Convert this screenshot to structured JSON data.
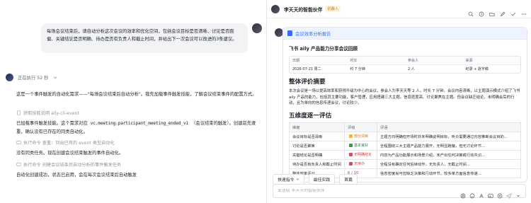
{
  "left": {
    "user_message": "每场会议结束后，请自动分析这次会议的效率和优化空间，包括会议目标是否清晰、讨论是否跑偏、关键结论是否明确、待办是否有负责人和截止时间，并给出下一次会议可以改进的3条建议。",
    "status": "正在执行 52 秒",
    "para1": "这是一个事件触发的自动化需求——\"每场会议结束后自动分析\"。我先加载事件触发技能，了解会议结束事件的配置方式。",
    "step1": "获取技能说明 aily-cli-event",
    "para2_a": "已加载事件触发技能。这个需求对应",
    "para2_code": "vc.meeting.participant_meeting_ended_v1",
    "para2_b": "（会议结束的触发）。创建前先查重，确认没有已存在的同类自动化。",
    "step2": "执行命令 查重：列出已有的 event 类型自动化",
    "para3": "没有同类任务。现在创建会议结束触发的事件自动化。",
    "step3": "执行命令 创建会议结束后自动分析的事件触发任务",
    "para4": "自动化创建成功，状态已启用，会在每次会议结束后自动触发"
  },
  "right": {
    "topbar": {
      "title": "李天天的智能伙伴",
      "badge": "机器人"
    },
    "card": {
      "header": "会议效率分析报告",
      "doc_title": "飞书 aily 产品能力分享会议回顾",
      "meta": {
        "labels": [
          "日期",
          "时长",
          "参会人",
          "来源"
        ],
        "values": [
          "2026-07-21 周二",
          "约 7 分钟",
          "2 人",
          "纪录 + 逐字稿"
        ]
      },
      "section1_title": "整体评价摘要",
      "summary": "本次会议是一场以提高效率和获得升级为中心的会议，参会人为李天天等 2 人，时长 7 分钟。会议内容清晰，以主题演示模式介绍了飞书 aily 产品的能力，包括其主要功能，客户管理，应用搭建三大主题。信息密度高、讨论聚焦在主题。但会议缺乏结论，未明确会后的行动，且为单向的信息传递会议，讨论较少。",
      "section2_title": "五维度逐一评估",
      "table_headers": [
        "维度",
        "评级",
        "评语"
      ],
      "rows": [
        {
          "dim": "会议目标是否清晰",
          "grade": "部分清晰",
          "type": "warn",
          "comment": "主题方向明确但开场时并未明确说明目标，听众需要通过内容推断会议目的..."
        },
        {
          "dim": "讨论是否聚焦",
          "grade": "基本良好",
          "type": "ok",
          "comment": "全程围绕三大主题产品能力展开，无明显跑偏，但无讨论环节..."
        },
        {
          "dim": "关键结论是否明确",
          "grade": "无明确结论",
          "type": "bad",
          "comment": "内容为产品功能展示和场景介绍，未产出任何决策或行动共识..."
        },
        {
          "dim": "待办是否有负责人和截止时间",
          "grade": "无待办",
          "type": "bad",
          "comment": "全程没有确定任何后续动作，无负责人，无截止时间..."
        },
        {
          "dim": "整体效率评分",
          "grade": "6 / 10",
          "type": "score",
          "comment": "信息密度尚可但缺乏决策和行动环节，较多单方面信息传递..."
        }
      ]
    },
    "quick_buttons": [
      "快速指令",
      "最佳实践",
      "首篇"
    ],
    "input_placeholder": "发送给 李天天的智能伙伴"
  }
}
